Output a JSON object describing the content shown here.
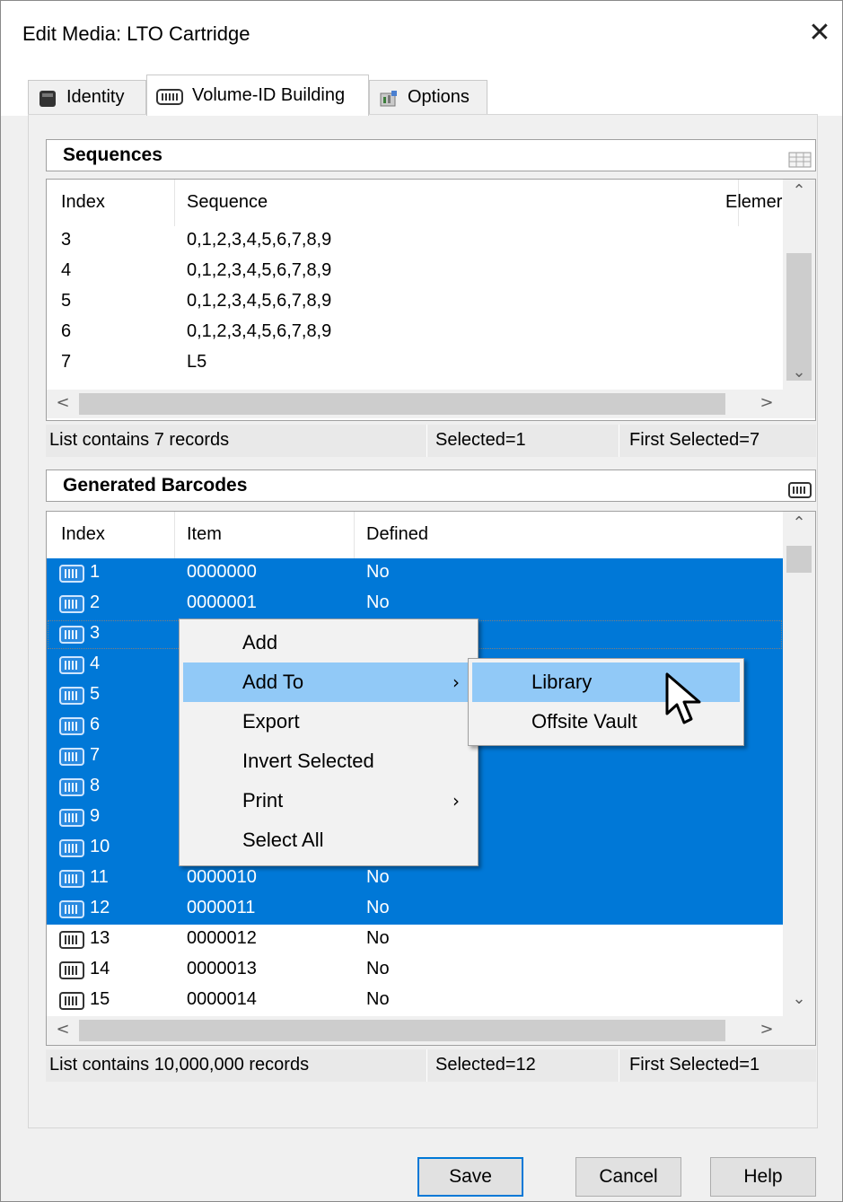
{
  "window": {
    "title": "Edit Media: LTO Cartridge",
    "close_glyph": "✕"
  },
  "tabs": [
    {
      "label": "Identity",
      "icon": "cartridge-icon"
    },
    {
      "label": "Volume-ID Building",
      "icon": "barcode-icon"
    },
    {
      "label": "Options",
      "icon": "options-icon"
    }
  ],
  "sequences": {
    "title": "Sequences",
    "columns": [
      "Index",
      "Sequence",
      "Elemer"
    ],
    "rows": [
      {
        "index": "3",
        "sequence": "0,1,2,3,4,5,6,7,8,9"
      },
      {
        "index": "4",
        "sequence": "0,1,2,3,4,5,6,7,8,9"
      },
      {
        "index": "5",
        "sequence": "0,1,2,3,4,5,6,7,8,9"
      },
      {
        "index": "6",
        "sequence": "0,1,2,3,4,5,6,7,8,9"
      },
      {
        "index": "7",
        "sequence": "L5"
      }
    ],
    "status": {
      "count": "List contains 7 records",
      "selected": "Selected=1",
      "first": "First Selected=7"
    }
  },
  "barcodes": {
    "title": "Generated Barcodes",
    "columns": [
      "Index",
      "Item",
      "Defined"
    ],
    "rows": [
      {
        "index": "1",
        "item": "0000000",
        "defined": "No"
      },
      {
        "index": "2",
        "item": "0000001",
        "defined": "No"
      },
      {
        "index": "3",
        "item": "",
        "defined": ""
      },
      {
        "index": "4",
        "item": "",
        "defined": ""
      },
      {
        "index": "5",
        "item": "",
        "defined": ""
      },
      {
        "index": "6",
        "item": "",
        "defined": ""
      },
      {
        "index": "7",
        "item": "",
        "defined": ""
      },
      {
        "index": "8",
        "item": "",
        "defined": ""
      },
      {
        "index": "9",
        "item": "",
        "defined": ""
      },
      {
        "index": "10",
        "item": "",
        "defined": ""
      },
      {
        "index": "11",
        "item": "0000010",
        "defined": "No"
      },
      {
        "index": "12",
        "item": "0000011",
        "defined": "No"
      },
      {
        "index": "13",
        "item": "0000012",
        "defined": "No"
      },
      {
        "index": "14",
        "item": "0000013",
        "defined": "No"
      },
      {
        "index": "15",
        "item": "0000014",
        "defined": "No"
      }
    ],
    "status": {
      "count": "List contains 10,000,000 records",
      "selected": "Selected=12",
      "first": "First Selected=1"
    }
  },
  "context_menu": {
    "items": [
      {
        "label": "Add",
        "submenu": false
      },
      {
        "label": "Add To",
        "submenu": true
      },
      {
        "label": "Export",
        "submenu": false
      },
      {
        "label": "Invert Selected",
        "submenu": false
      },
      {
        "label": "Print",
        "submenu": true
      },
      {
        "label": "Select All",
        "submenu": false
      }
    ],
    "highlighted": "Add To",
    "arrow": "›"
  },
  "submenu": {
    "items": [
      {
        "label": "Library"
      },
      {
        "label": "Offsite Vault"
      }
    ],
    "highlighted": "Library"
  },
  "buttons": {
    "save": "Save",
    "cancel": "Cancel",
    "help": "Help"
  },
  "scroll_glyphs": {
    "up": "⌃",
    "down": "⌄",
    "left": "<",
    "right": ">"
  },
  "colors": {
    "selection": "#0078d7",
    "menu_highlight": "#91c9f7",
    "default_button_border": "#0078d7"
  }
}
